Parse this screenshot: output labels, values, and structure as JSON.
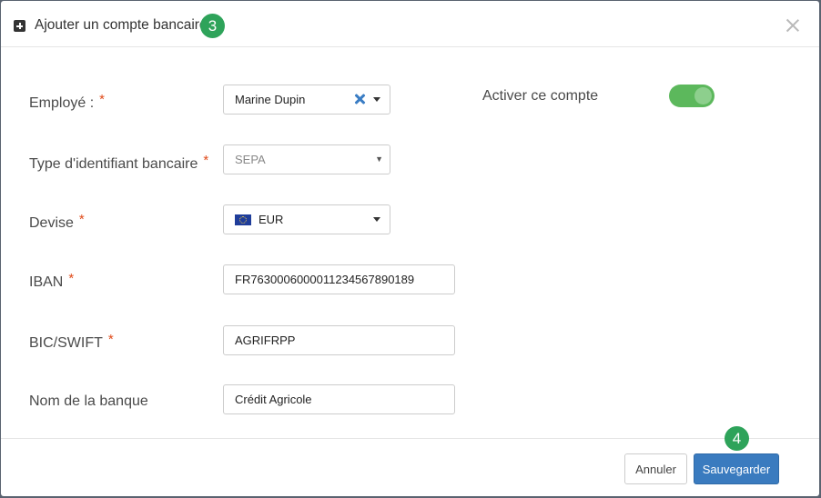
{
  "modal": {
    "title": "Ajouter un compte bancaire",
    "step_badge_header": "3",
    "step_badge_footer": "4"
  },
  "form": {
    "employee": {
      "label": "Employé :",
      "required": "*",
      "value": "Marine Dupin"
    },
    "id_type": {
      "label": "Type d'identifiant bancaire",
      "required": "*",
      "value": "SEPA"
    },
    "currency": {
      "label": "Devise",
      "required": "*",
      "value": "EUR",
      "flag_icon": "eu-flag-icon"
    },
    "iban": {
      "label": "IBAN",
      "required": "*",
      "value": "FR7630006000011234567890189"
    },
    "bic": {
      "label": "BIC/SWIFT",
      "required": "*",
      "value": "AGRIFRPP"
    },
    "bank_name": {
      "label": "Nom de la banque",
      "value": "Crédit Agricole"
    },
    "activate": {
      "label": "Activer ce compte",
      "state": "on"
    }
  },
  "footer": {
    "cancel_label": "Annuler",
    "save_label": "Sauvegarder"
  },
  "colors": {
    "primary": "#3a7bbf",
    "badge": "#2ea35a",
    "toggle_on": "#5cb85c",
    "required": "#e04b1a"
  }
}
